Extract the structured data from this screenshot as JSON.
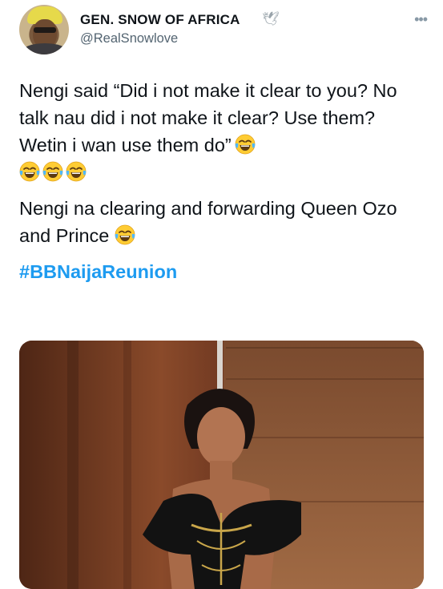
{
  "author": {
    "display_name": "GEN. SNOW OF AFRICA",
    "display_name_icon": "dove-icon",
    "handle": "@RealSnowlove",
    "avatar_icon": "avatar-photo"
  },
  "menu": {
    "icon": "more-horizontal-icon"
  },
  "tweet": {
    "paragraph1": "Nengi said “Did i not make it clear to you? No talk nau did i not make it clear? Use them? Wetin i wan use them do”",
    "paragraph2": "Nengi na clearing and forwarding Queen Ozo and Prince",
    "hashtag": "#BBNaijaReunion",
    "emoji": "face-with-tears-of-joy"
  },
  "colors": {
    "text": "#0f1419",
    "secondary": "#536471",
    "link": "#1d9bf0",
    "background": "#ffffff"
  },
  "media": {
    "icon": "photo-image"
  }
}
